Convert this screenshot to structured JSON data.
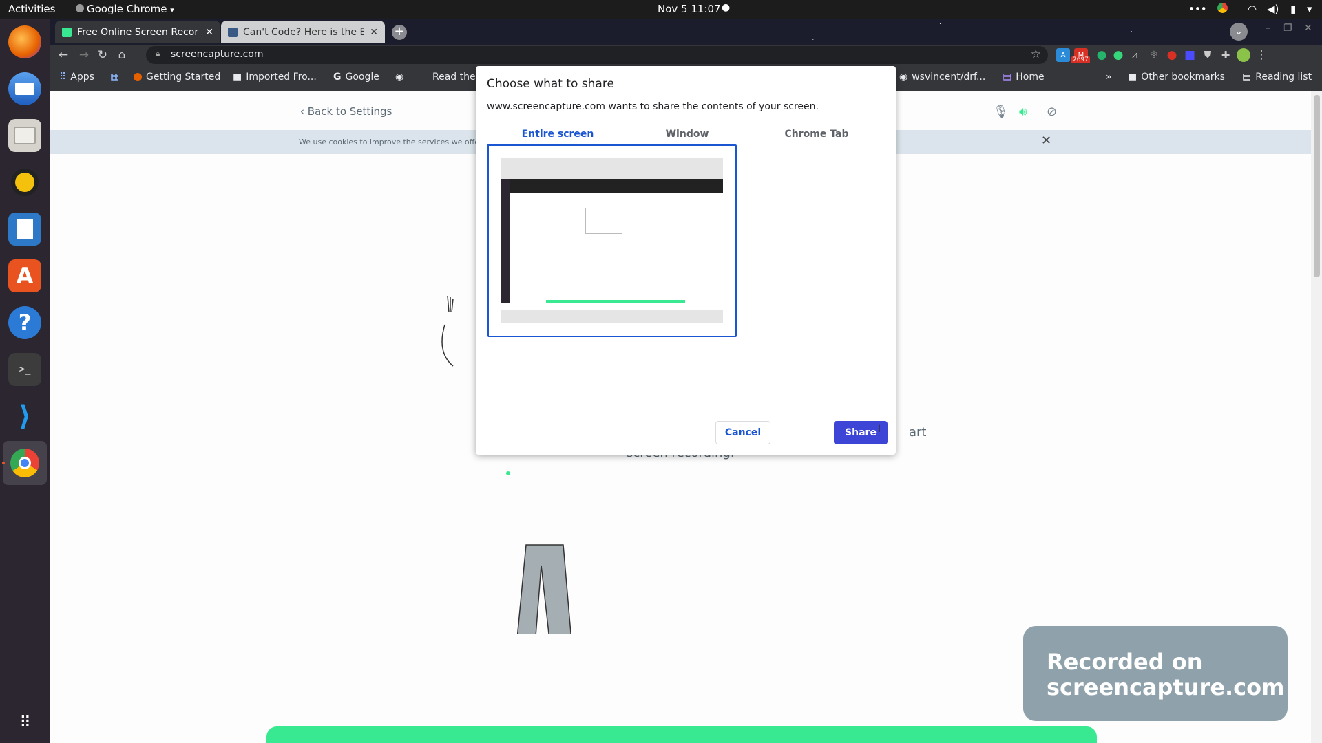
{
  "system_bar": {
    "activities": "Activities",
    "app_menu": "Google Chrome",
    "clock": "Nov 5  11:07"
  },
  "dock": {
    "apps": [
      "firefox-icon",
      "thunderbird-icon",
      "files-icon",
      "rhythmbox-icon",
      "libreoffice-writer-icon",
      "ubuntu-software-icon",
      "help-icon",
      "terminal-icon",
      "vscode-icon",
      "chrome-icon"
    ]
  },
  "browser": {
    "tabs": [
      {
        "label": "Free Online Screen Recor",
        "active": true
      },
      {
        "label": "Can't Code? Here is the Be",
        "active": false
      }
    ],
    "address": "screencapture.com",
    "bookmarks": {
      "apps": "Apps",
      "items": [
        "Getting Started",
        "Imported Fro...",
        "Google",
        "Read the",
        "wsvincent/drf...",
        "Home"
      ],
      "overflow": "»",
      "other": "Other bookmarks",
      "reading_list": "Reading list"
    },
    "extension_badge": "2697"
  },
  "page": {
    "back_link": "Back to Settings",
    "cookie_text": "We use cookies to improve the services we offe",
    "instruction_fragment_1": "art",
    "instruction_fragment_2": "screen recording.",
    "badge_line1": "Recorded on",
    "badge_line2": "screencapture.com"
  },
  "dialog": {
    "title": "Choose what to share",
    "description": "www.screencapture.com wants to share the contents of your screen.",
    "tabs": [
      "Entire screen",
      "Window",
      "Chrome Tab"
    ],
    "active_tab": "Entire screen",
    "cancel": "Cancel",
    "share": "Share"
  },
  "colors": {
    "accent": "#1a55d2",
    "share_button": "#3d45d6",
    "brand_green": "#38e991"
  }
}
